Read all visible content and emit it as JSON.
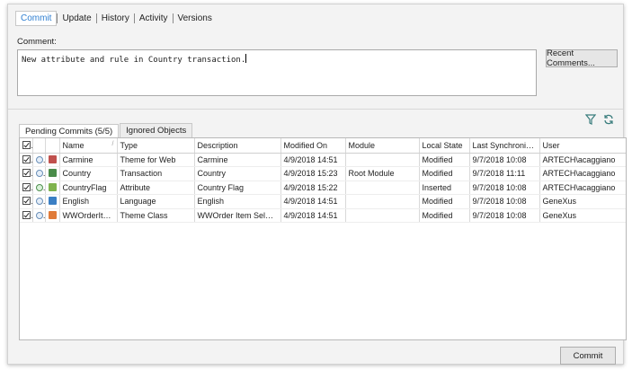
{
  "tabs": [
    {
      "label": "Commit",
      "active": true
    },
    {
      "label": "Update",
      "active": false
    },
    {
      "label": "History",
      "active": false
    },
    {
      "label": "Activity",
      "active": false
    },
    {
      "label": "Versions",
      "active": false
    }
  ],
  "comment": {
    "label": "Comment:",
    "value": "New attribute and rule in Country transaction."
  },
  "recent_comments_label": "Recent Comments...",
  "lower_tabs": [
    {
      "label": "Pending Commits (5/5)",
      "active": true
    },
    {
      "label": "Ignored Objects",
      "active": false
    }
  ],
  "icons": {
    "filter": "filter-icon",
    "refresh": "refresh-icon"
  },
  "columns": [
    "Name",
    "Type",
    "Description",
    "Modified On",
    "Module",
    "Local State",
    "Last Synchronized",
    "User"
  ],
  "rows": [
    {
      "name": "Carmine",
      "type": "Theme for Web",
      "description": "Carmine",
      "modified_on": "4/9/2018 14:51",
      "module": "",
      "local_state": "Modified",
      "last_sync": "9/7/2018 10:08",
      "user": "ARTECH\\acaggiano",
      "state_icon": "modified",
      "obj_color": "#c0504d"
    },
    {
      "name": "Country",
      "type": "Transaction",
      "description": "Country",
      "modified_on": "4/9/2018 15:23",
      "module": "Root Module",
      "local_state": "Modified",
      "last_sync": "9/7/2018 11:11",
      "user": "ARTECH\\acaggiano",
      "state_icon": "modified",
      "obj_color": "#4a8c4a"
    },
    {
      "name": "CountryFlag",
      "type": "Attribute",
      "description": "Country Flag",
      "modified_on": "4/9/2018 15:22",
      "module": "",
      "local_state": "Inserted",
      "last_sync": "9/7/2018 10:08",
      "user": "ARTECH\\acaggiano",
      "state_icon": "inserted",
      "obj_color": "#7fb34d"
    },
    {
      "name": "English",
      "type": "Language",
      "description": "English",
      "modified_on": "4/9/2018 14:51",
      "module": "",
      "local_state": "Modified",
      "last_sync": "9/7/2018 10:08",
      "user": "GeneXus",
      "state_icon": "modified",
      "obj_color": "#3b7fc4"
    },
    {
      "name": "WWOrderItem...",
      "type": "Theme Class",
      "description": "WWOrder Item Selected",
      "modified_on": "4/9/2018 14:51",
      "module": "",
      "local_state": "Modified",
      "last_sync": "9/7/2018 10:08",
      "user": "GeneXus",
      "state_icon": "modified",
      "obj_color": "#e07b39"
    }
  ],
  "commit_button_label": "Commit"
}
